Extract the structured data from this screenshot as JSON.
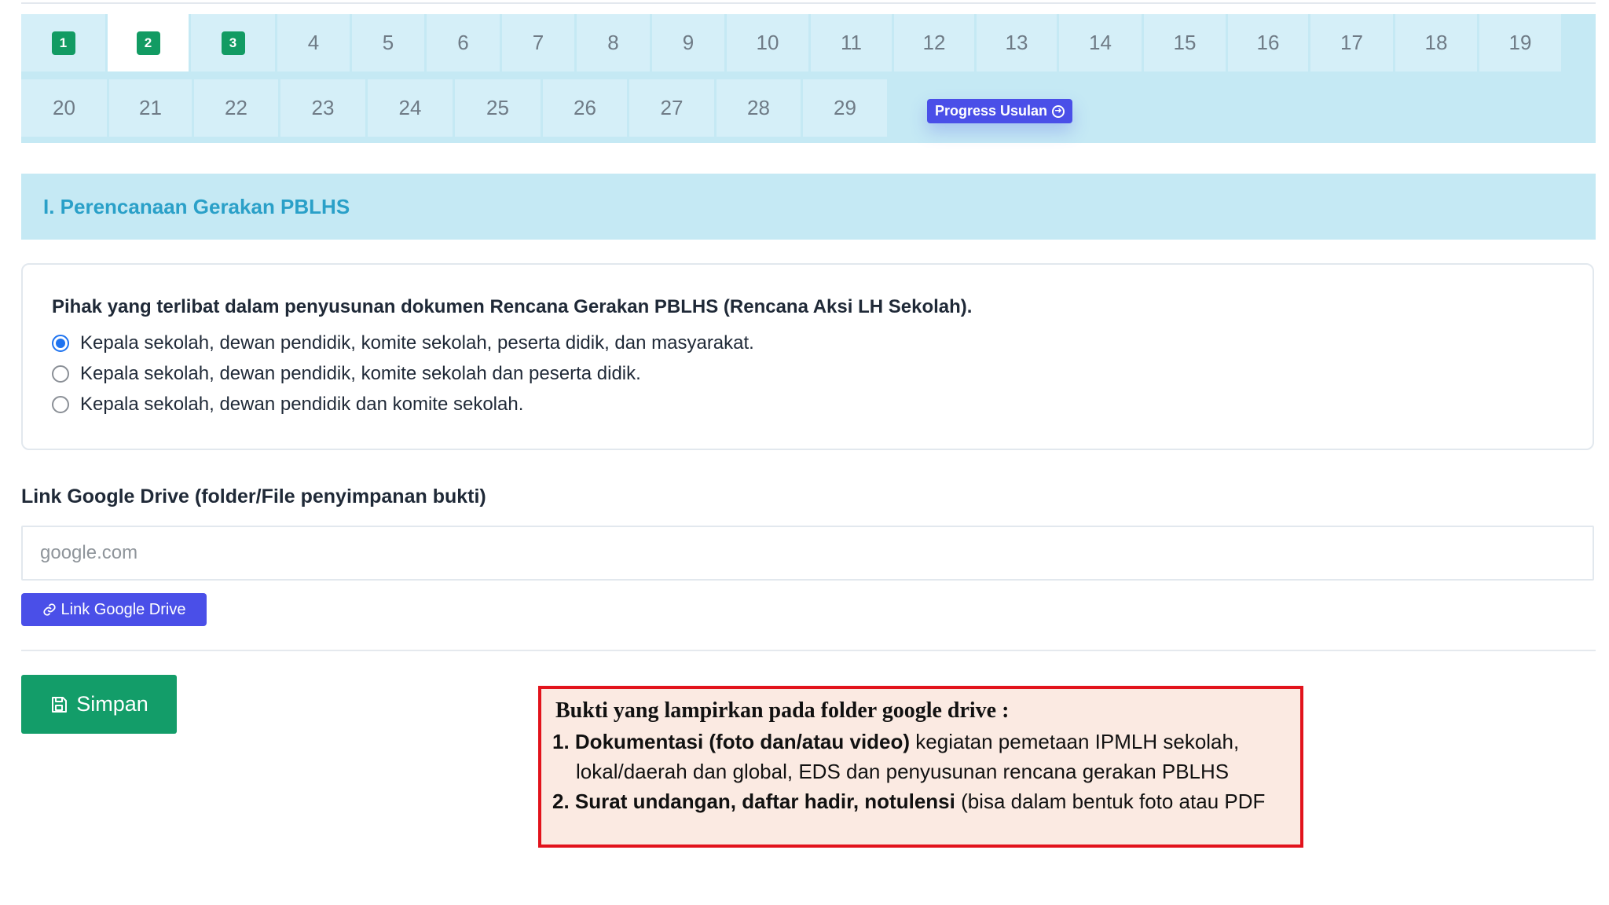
{
  "question_nav": {
    "active": 2,
    "answered": [
      1,
      2,
      3
    ],
    "items": [
      "1",
      "2",
      "3",
      "4",
      "5",
      "6",
      "7",
      "8",
      "9",
      "10",
      "11",
      "12",
      "13",
      "14",
      "15",
      "16",
      "17",
      "18",
      "19",
      "20",
      "21",
      "22",
      "23",
      "24",
      "25",
      "26",
      "27",
      "28",
      "29"
    ],
    "progress_label": "Progress Usulan"
  },
  "section": {
    "title": "I. Perencanaan Gerakan PBLHS"
  },
  "question": {
    "text": "Pihak yang terlibat dalam penyusunan dokumen Rencana Gerakan PBLHS (Rencana Aksi LH Sekolah).",
    "options": [
      "Kepala sekolah, dewan pendidik, komite sekolah, peserta didik, dan masyarakat.",
      "Kepala sekolah, dewan pendidik, komite sekolah dan peserta didik.",
      "Kepala sekolah, dewan pendidik dan komite sekolah."
    ],
    "selected_index": 0
  },
  "drive_link": {
    "label": "Link Google Drive (folder/File penyimpanan bukti)",
    "placeholder": "google.com",
    "button_label": "Link Google Drive"
  },
  "save_label": "Simpan",
  "annotation": {
    "title": "Bukti yang lampirkan pada folder google drive  :",
    "item1_bold": "1. Dokumentasi  (foto  dan/atau  video)",
    "item1_rest": "  kegiatan  pemetaan  IPMLH  sekolah,",
    "item1_cont": "lokal/daerah dan global, EDS dan  penyusunan rencana gerakan PBLHS",
    "item2_bold": "2. Surat undangan, daftar hadir, notulensi",
    "item2_rest": " (bisa dalam bentuk foto atau PDF"
  },
  "colors": {
    "nav_bg": "#c5e9f4",
    "answered_chip": "#129b63",
    "primary_button": "#4a4fe8",
    "save_button": "#139d69",
    "section_title": "#2aa0c8",
    "annotation_border": "#e2131c",
    "annotation_bg": "#fbeae2"
  }
}
